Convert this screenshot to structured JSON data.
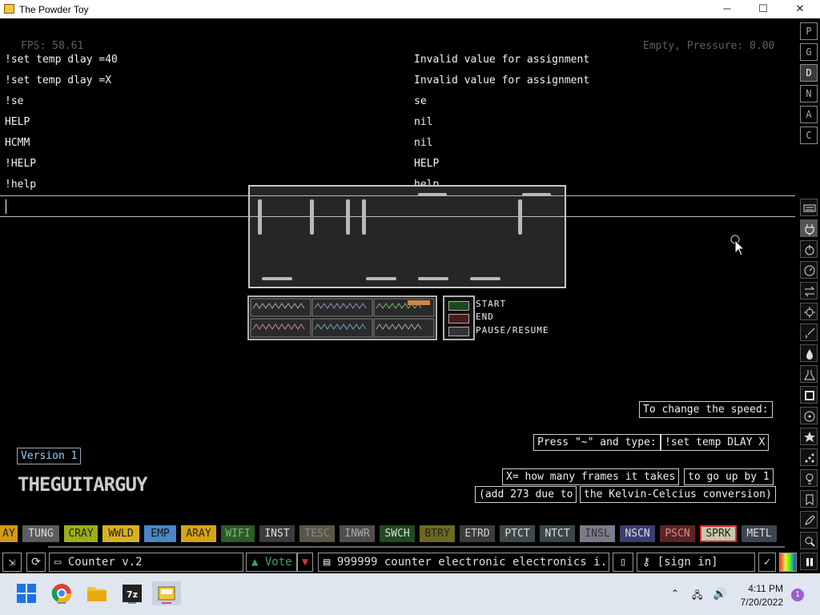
{
  "window": {
    "title": "The Powder Toy",
    "minimize": "─",
    "maximize": "☐",
    "close": "✕"
  },
  "hud": {
    "fps": "FPS: 58.61",
    "status": "Empty, Pressure: 0.00"
  },
  "console": {
    "lines": [
      {
        "cmd": "!set temp dlay =40",
        "result": "Invalid value for assignment"
      },
      {
        "cmd": "!set temp dlay =X",
        "result": "Invalid value for assignment"
      },
      {
        "cmd": "!se",
        "result": "se"
      },
      {
        "cmd": "HELP",
        "result": "nil"
      },
      {
        "cmd": "HCMM",
        "result": "nil"
      },
      {
        "cmd": "!HELP",
        "result": "HELP"
      },
      {
        "cmd": "!help",
        "result": "help"
      }
    ],
    "input_value": ""
  },
  "right_menu": [
    "P",
    "G",
    "D",
    "N",
    "A",
    "C"
  ],
  "right_tools": [
    "keyboard-icon",
    "plug-icon",
    "power-icon",
    "gauge-icon",
    "arrows-icon",
    "gear-icon",
    "brush-icon",
    "drop-icon",
    "flask-icon",
    "square-icon",
    "radiation-icon",
    "star-icon",
    "dots-icon",
    "bulb-icon",
    "bookmark-icon",
    "pen-icon",
    "search-icon",
    "pause-icon"
  ],
  "creation": {
    "controls": [
      "START",
      "END",
      "PAUSE/RESUME"
    ],
    "speed_hint": "To change the speed:",
    "press_text": "Press \"~\" and type:",
    "command_text": "!set temp DLAY X",
    "x_text": "X= how many frames it takes",
    "x_text2": "to go up by 1",
    "add_text": "(add 273 due to",
    "add_text2": "the Kelvin-Celcius conversion)",
    "version": "Version 1",
    "author": "THEGUITARGUY"
  },
  "elements": [
    {
      "name": "AY",
      "color": "#d69a14",
      "text": "#222"
    },
    {
      "name": "TUNG",
      "color": "#5d5d5d",
      "text": "#ddd"
    },
    {
      "name": "CRAY",
      "color": "#9dae16",
      "text": "#222"
    },
    {
      "name": "WWLD",
      "color": "#d8b21a",
      "text": "#222"
    },
    {
      "name": "EMP",
      "color": "#4a86c8",
      "text": "#111"
    },
    {
      "name": "ARAY",
      "color": "#d8a413",
      "text": "#222"
    },
    {
      "name": "WIFI",
      "color": "#2c5a2a",
      "text": "#7ab870"
    },
    {
      "name": "INST",
      "color": "#3c3c3c",
      "text": "#ddd"
    },
    {
      "name": "TESC",
      "color": "#5a5646",
      "text": "#888"
    },
    {
      "name": "INWR",
      "color": "#4e4e4e",
      "text": "#aaa"
    },
    {
      "name": "SWCH",
      "color": "#224a22",
      "text": "#ddd"
    },
    {
      "name": "BTRY",
      "color": "#6c6a1f",
      "text": "#222"
    },
    {
      "name": "ETRD",
      "color": "#3c3c3c",
      "text": "#ccc"
    },
    {
      "name": "PTCT",
      "color": "#3e4a4a",
      "text": "#ddd"
    },
    {
      "name": "NTCT",
      "color": "#394747",
      "text": "#ddd"
    },
    {
      "name": "INSL",
      "color": "#7a7a8a",
      "text": "#333"
    },
    {
      "name": "NSCN",
      "color": "#3c3e72",
      "text": "#ddd"
    },
    {
      "name": "PSCN",
      "color": "#5c2424",
      "text": "#d88"
    },
    {
      "name": "SPRK",
      "color": "#c8c8a8",
      "text": "#222"
    },
    {
      "name": "METL",
      "color": "#3e4452",
      "text": "#ddd"
    }
  ],
  "selected_element": "SPRK",
  "bottom": {
    "save_name": "Counter v.2",
    "vote": "Vote",
    "tags": "999999 counter electronic electronics i...",
    "sign_in": "[sign in]"
  },
  "taskbar": {
    "time": "4:11 PM",
    "date": "7/20/2022",
    "notifications": "1"
  },
  "colors": {
    "accent_selected": "#e03030",
    "taskbar_bg": "#dfe6ef"
  }
}
